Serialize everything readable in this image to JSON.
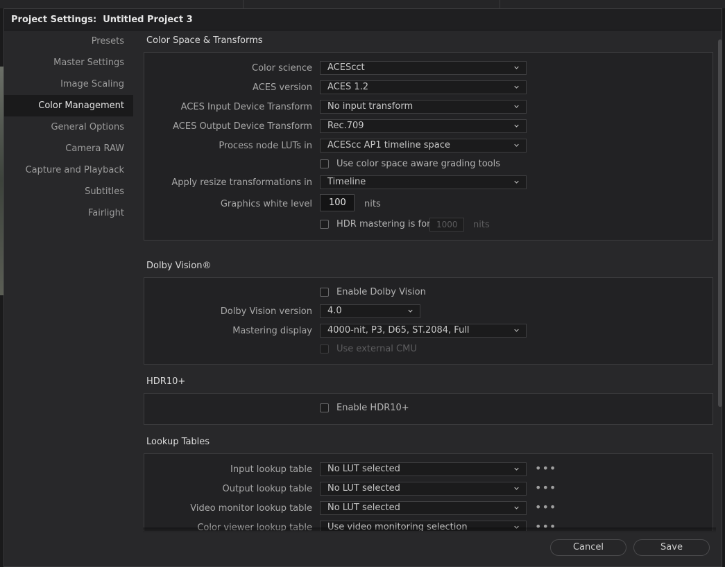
{
  "title": "Project Settings:  Untitled Project 3",
  "sidebar": {
    "items": [
      {
        "label": "Presets"
      },
      {
        "label": "Master Settings"
      },
      {
        "label": "Image Scaling"
      },
      {
        "label": "Color Management"
      },
      {
        "label": "General Options"
      },
      {
        "label": "Camera RAW"
      },
      {
        "label": "Capture and Playback"
      },
      {
        "label": "Subtitles"
      },
      {
        "label": "Fairlight"
      }
    ],
    "active": "Color Management"
  },
  "color_space": {
    "title": "Color Space & Transforms",
    "color_science": {
      "label": "Color science",
      "value": "ACEScct"
    },
    "aces_version": {
      "label": "ACES version",
      "value": "ACES 1.2"
    },
    "aces_idt": {
      "label": "ACES Input Device Transform",
      "value": "No input transform"
    },
    "aces_odt": {
      "label": "ACES Output Device Transform",
      "value": "Rec.709"
    },
    "process_luts": {
      "label": "Process node LUTs in",
      "value": "ACEScc AP1 timeline space"
    },
    "color_aware_tools": {
      "label": "Use color space aware grading tools",
      "checked": false
    },
    "resize_transform": {
      "label": "Apply resize transformations in",
      "value": "Timeline"
    },
    "white_level": {
      "label": "Graphics white level",
      "value": "100",
      "unit": "nits"
    },
    "hdr_mastering": {
      "label": "HDR mastering is for",
      "value": "1000",
      "unit": "nits",
      "checked": false
    }
  },
  "dolby": {
    "title": "Dolby Vision®",
    "enable": {
      "label": "Enable Dolby Vision",
      "checked": false
    },
    "version": {
      "label": "Dolby Vision version",
      "value": "4.0"
    },
    "mastering_display": {
      "label": "Mastering display",
      "value": "4000-nit, P3, D65, ST.2084, Full"
    },
    "external_cmu": {
      "label": "Use external CMU",
      "checked": false
    }
  },
  "hdr10": {
    "title": "HDR10+",
    "enable": {
      "label": "Enable HDR10+",
      "checked": false
    }
  },
  "luts": {
    "title": "Lookup Tables",
    "input": {
      "label": "Input lookup table",
      "value": "No LUT selected"
    },
    "output": {
      "label": "Output lookup table",
      "value": "No LUT selected"
    },
    "video_monitor": {
      "label": "Video monitor lookup table",
      "value": "No LUT selected"
    },
    "color_viewer": {
      "label": "Color viewer lookup table",
      "value": "Use video monitoring selection"
    },
    "more_glyph": "•••"
  },
  "footer": {
    "cancel": "Cancel",
    "save": "Save"
  },
  "icons": {
    "dropdown": "chevron-down-icon",
    "more": "more-horizontal-icon"
  },
  "colors": {
    "background": "#28282a",
    "panel": "#222224",
    "active_nav": "#1a1a1b"
  }
}
